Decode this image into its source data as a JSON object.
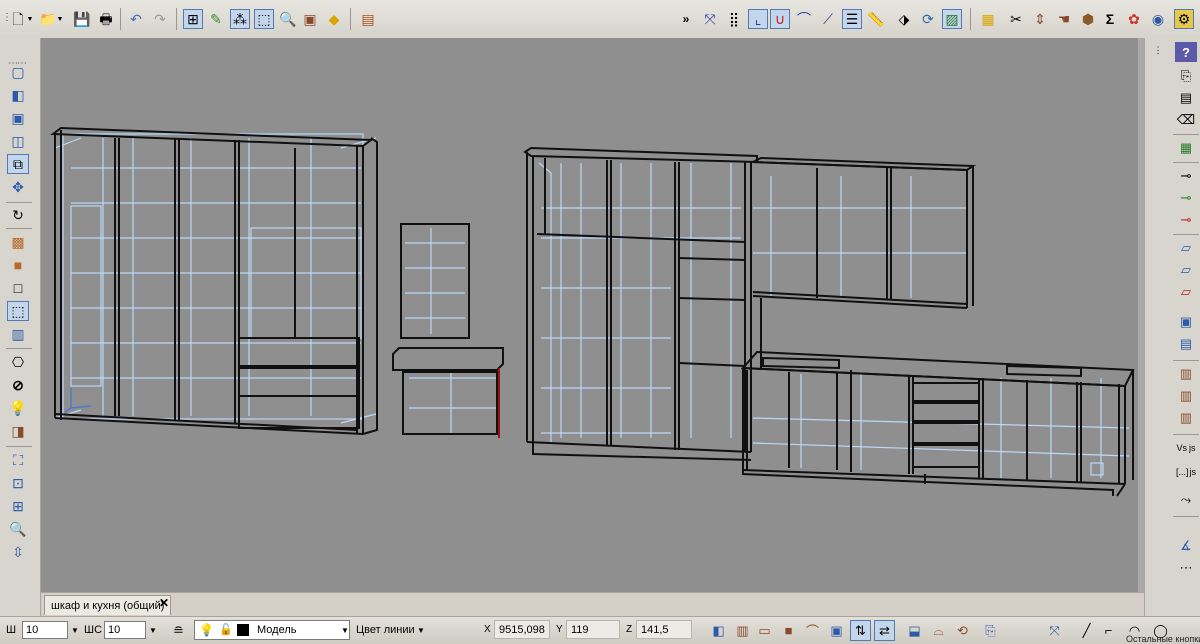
{
  "toolbar_top": {
    "icons": [
      "new-document-icon",
      "open-folder-icon",
      "save-icon",
      "print-icon",
      "undo-icon",
      "redo-icon",
      "object-tree-icon",
      "edit-icon",
      "grid-icon",
      "select-icon",
      "zoom-icon",
      "material-icon",
      "paint-icon",
      "panel-icon",
      "snap-axis-icon",
      "snap-grid-icon",
      "snap-point-icon",
      "magnet-icon",
      "snap-curve-icon",
      "layers-icon",
      "ruler-icon",
      "texture-icon",
      "rotate-icon",
      "frame-icon",
      "package-icon",
      "scissors-icon",
      "align-icon",
      "hand-icon",
      "box-icon",
      "sigma-icon",
      "color-icon",
      "eye-icon",
      "settings-icon"
    ],
    "overflow_label": "»"
  },
  "toolbar_left": {
    "icons": [
      "view-front-icon",
      "view-iso-icon",
      "view-side-icon",
      "view-top-icon",
      "wireframe-icon",
      "move-icon",
      "rotate-view-icon",
      "texture-view-icon",
      "shaded-view-icon",
      "outline-view-icon",
      "transparent-view-icon",
      "panels-view-icon",
      "camera-icon",
      "render-icon",
      "light-icon",
      "object-icon",
      "fit-all-icon",
      "fit-window-icon",
      "zoom-region-icon",
      "zoom-icon",
      "pan-icon"
    ]
  },
  "toolbar_right": {
    "icons": [
      "help-icon",
      "copy-icon",
      "paste-icon",
      "delete-icon",
      "replace-icon",
      "fastener-icon",
      "fastener-add-icon",
      "fastener-remove-icon",
      "panel-add-icon",
      "panel-edit-icon",
      "panel-remove-icon",
      "panel-move-icon",
      "panel-copy-icon",
      "cabinet-icon",
      "cabinet-add-icon",
      "cabinet-edit-icon",
      "variables-icon",
      "script-icon",
      "curve-icon",
      "angle-icon"
    ],
    "labels": [
      "Vs",
      "js",
      "[...]",
      "js"
    ]
  },
  "tabs": [
    {
      "label": "шкаф и кухня (общий)"
    }
  ],
  "status": {
    "w_label": "Ш",
    "w_value": "10",
    "ws_label": "ШС",
    "ws_value": "10",
    "layer_value": "Модель",
    "line_color": "Цвет линии",
    "x_label": "X",
    "x_value": "9515,098",
    "y_label": "Y",
    "y_value": "119",
    "z_label": "Z",
    "z_value": "141,5",
    "more_buttons": "Остальные кнопки"
  },
  "colors": {
    "viewport_bg": "#8f8f8f",
    "wire_light": "#bcd8f8",
    "wire_dark": "#101010",
    "accent": "#557ab0"
  }
}
